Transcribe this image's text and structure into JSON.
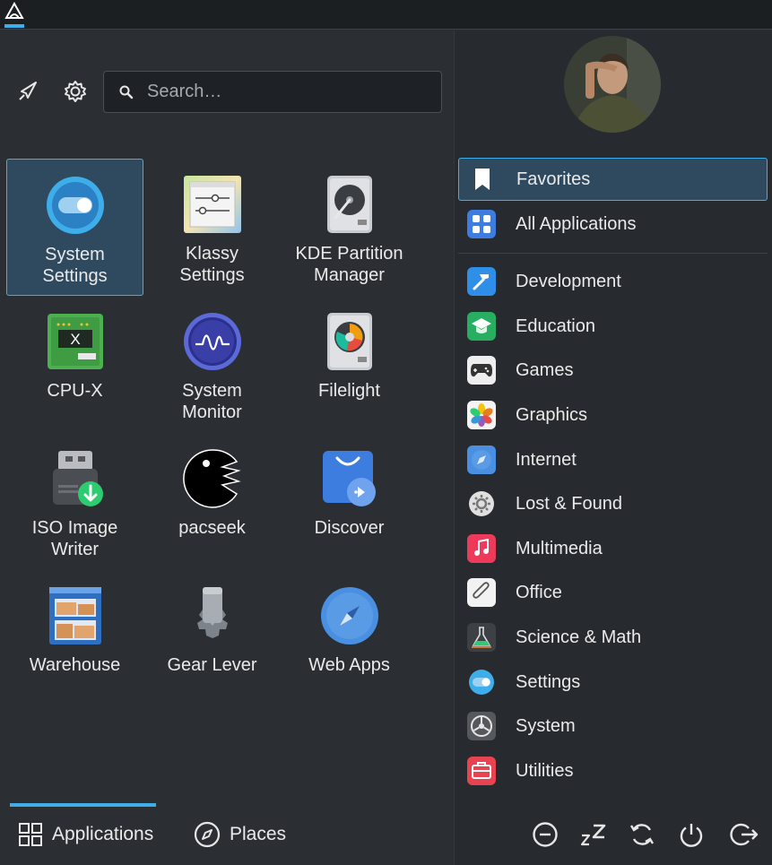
{
  "search": {
    "placeholder": "Search…"
  },
  "apps": [
    {
      "label": "System\nSettings",
      "icon": "system-settings-icon"
    },
    {
      "label": "Klassy\nSettings",
      "icon": "klassy-settings-icon"
    },
    {
      "label": "KDE Partition\nManager",
      "icon": "partition-manager-icon"
    },
    {
      "label": "CPU-X",
      "icon": "cpu-x-icon"
    },
    {
      "label": "System\nMonitor",
      "icon": "system-monitor-icon"
    },
    {
      "label": "Filelight",
      "icon": "filelight-icon"
    },
    {
      "label": "ISO Image\nWriter",
      "icon": "iso-image-writer-icon"
    },
    {
      "label": "pacseek",
      "icon": "pacseek-icon"
    },
    {
      "label": "Discover",
      "icon": "discover-icon"
    },
    {
      "label": "Warehouse",
      "icon": "warehouse-icon"
    },
    {
      "label": "Gear Lever",
      "icon": "gear-lever-icon"
    },
    {
      "label": "Web Apps",
      "icon": "web-apps-icon"
    }
  ],
  "categories": [
    {
      "label": "Favorites",
      "icon": "bookmark-icon",
      "selected": true
    },
    {
      "label": "All Applications",
      "icon": "all-apps-icon"
    },
    {
      "label": "Development",
      "icon": "development-icon"
    },
    {
      "label": "Education",
      "icon": "education-icon"
    },
    {
      "label": "Games",
      "icon": "gamepad-icon"
    },
    {
      "label": "Graphics",
      "icon": "graphics-icon"
    },
    {
      "label": "Internet",
      "icon": "internet-icon"
    },
    {
      "label": "Lost & Found",
      "icon": "lost-found-icon"
    },
    {
      "label": "Multimedia",
      "icon": "multimedia-icon"
    },
    {
      "label": "Office",
      "icon": "office-icon"
    },
    {
      "label": "Science & Math",
      "icon": "science-icon"
    },
    {
      "label": "Settings",
      "icon": "settings-icon"
    },
    {
      "label": "System",
      "icon": "system-icon"
    },
    {
      "label": "Utilities",
      "icon": "utilities-icon"
    }
  ],
  "tabs": {
    "applications": "Applications",
    "places": "Places"
  },
  "colors": {
    "accent": "#3daee9",
    "selected_bg": "#2f4a5f"
  }
}
